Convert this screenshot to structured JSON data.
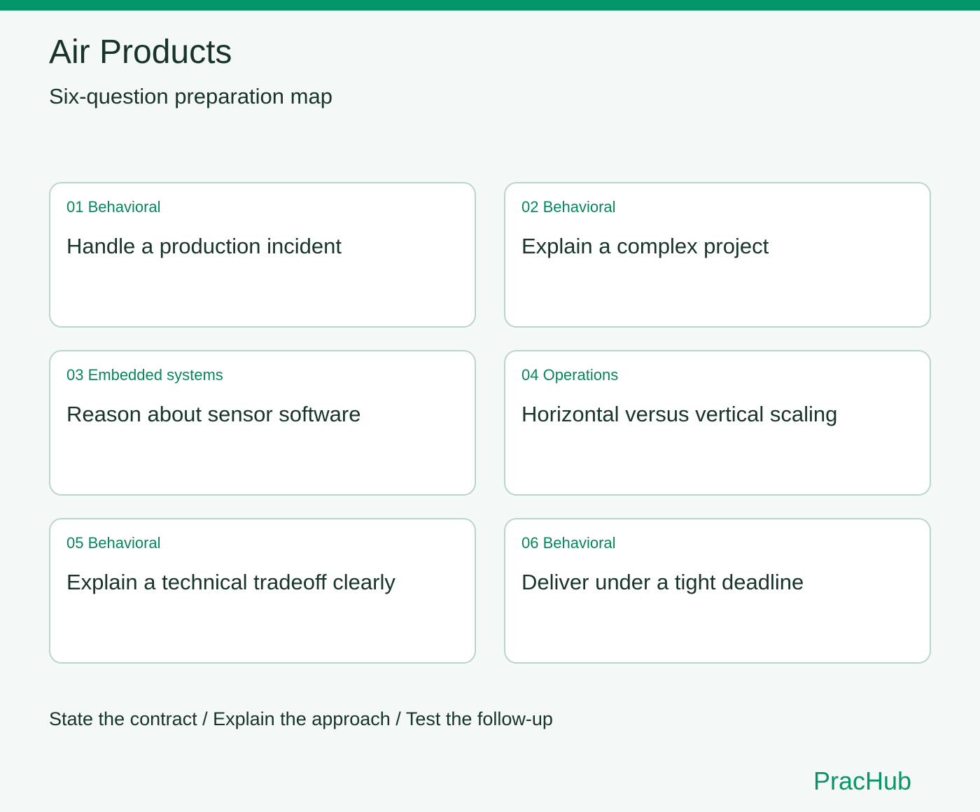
{
  "header": {
    "title": "Air Products",
    "subtitle": "Six-question preparation map"
  },
  "cards": [
    {
      "tag": "01 Behavioral",
      "title": "Handle a production incident"
    },
    {
      "tag": "02 Behavioral",
      "title": "Explain a complex project"
    },
    {
      "tag": "03 Embedded systems",
      "title": "Reason about sensor software"
    },
    {
      "tag": "04 Operations",
      "title": "Horizontal versus vertical scaling"
    },
    {
      "tag": "05 Behavioral",
      "title": "Explain a technical tradeoff clearly"
    },
    {
      "tag": "06 Behavioral",
      "title": "Deliver under a tight deadline"
    }
  ],
  "footer": {
    "steps": "State the contract / Explain the approach / Test the follow-up",
    "brand": "PracHub"
  },
  "colors": {
    "accent": "#03956a",
    "tag_text": "#08855d",
    "card_border": "#b9d6cc",
    "background": "#f4f8f6",
    "text": "#17332c"
  }
}
